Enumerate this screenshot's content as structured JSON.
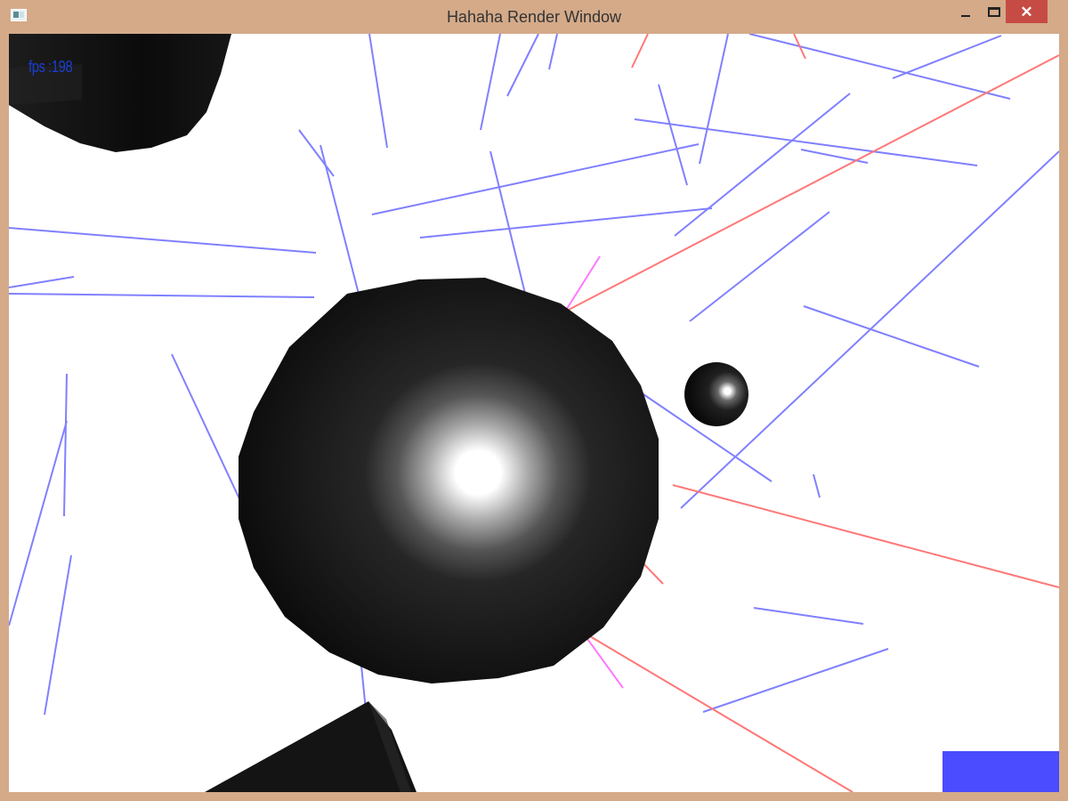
{
  "window": {
    "title": "Hahaha Render Window",
    "icon": "app-window-icon",
    "controls": {
      "minimize_icon": "minimize-icon",
      "maximize_icon": "maximize-icon",
      "close_icon": "close-icon",
      "close_glyph": "✕"
    }
  },
  "scene": {
    "fps_text": "fps :198",
    "background_color": "#ffffff",
    "blue_line_color": "#8080ff",
    "red_line_color": "#ff7777",
    "magenta_line_color": "#ff77ff",
    "sphere_color": "#111111",
    "swatch_color": "#4b4bff"
  }
}
